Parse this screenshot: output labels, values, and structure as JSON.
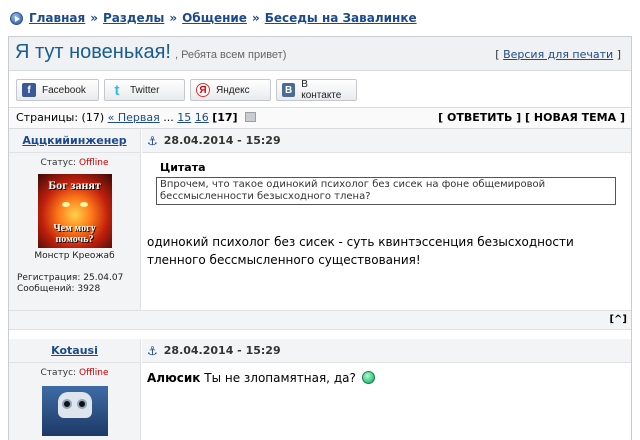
{
  "breadcrumbs": {
    "items": [
      "Главная",
      "Разделы",
      "Общение",
      "Беседы на Завалинке"
    ],
    "separator": "»"
  },
  "topic": {
    "title": "Я тут новенькая!",
    "subtitle": ", Ребята всем привет)",
    "print_prefix": "[",
    "print_label": "Версия для печати",
    "print_suffix": "]"
  },
  "share": [
    {
      "label": "Facebook",
      "icon": "facebook-icon",
      "glyph": "f"
    },
    {
      "label": "Twitter",
      "icon": "twitter-icon",
      "glyph": "t"
    },
    {
      "label": "Яндекс",
      "icon": "yandex-icon",
      "glyph": "Я"
    },
    {
      "label": "В контакте",
      "icon": "vkontakte-icon",
      "glyph": "B"
    }
  ],
  "pagination": {
    "prefix": "Страницы:",
    "count": "(17)",
    "first": "« Первая",
    "ellipsis": "...",
    "pages": [
      "15",
      "16"
    ],
    "current": "[17]"
  },
  "actions": {
    "reply": "[ ОТВЕТИТЬ ]",
    "new_topic": "[ НОВАЯ ТЕМА ]"
  },
  "posts": [
    {
      "author": "Аццкийинженер",
      "status_label": "Статус:",
      "status": "Offline",
      "avatar_top": "Бог занят",
      "avatar_bottom": "Чем могу помочь?",
      "rank": "Монстр Креожаб",
      "reg_label": "Регистрация:",
      "reg_date": "25.04.07",
      "msgs_label": "Сообщений:",
      "msgs": "3928",
      "anchor": "⚓",
      "date": "28.04.2014 - 15:29",
      "quote_title": "Цитата",
      "quote_text": "Впрочем, что такое одинокий психолог без сисек на фоне общемировой бессмысленности безысходного тлена?",
      "text": "одинокий психолог без сисек - суть квинтэссенция безысходности тленного бессмысленного существования!",
      "up_label": "[^]"
    },
    {
      "author": "Kotausi",
      "status_label": "Статус:",
      "status": "Offline",
      "anchor": "⚓",
      "date": "28.04.2014 - 15:29",
      "addressee": "Алюсик",
      "text": "Ты не злопамятная, да?"
    }
  ]
}
